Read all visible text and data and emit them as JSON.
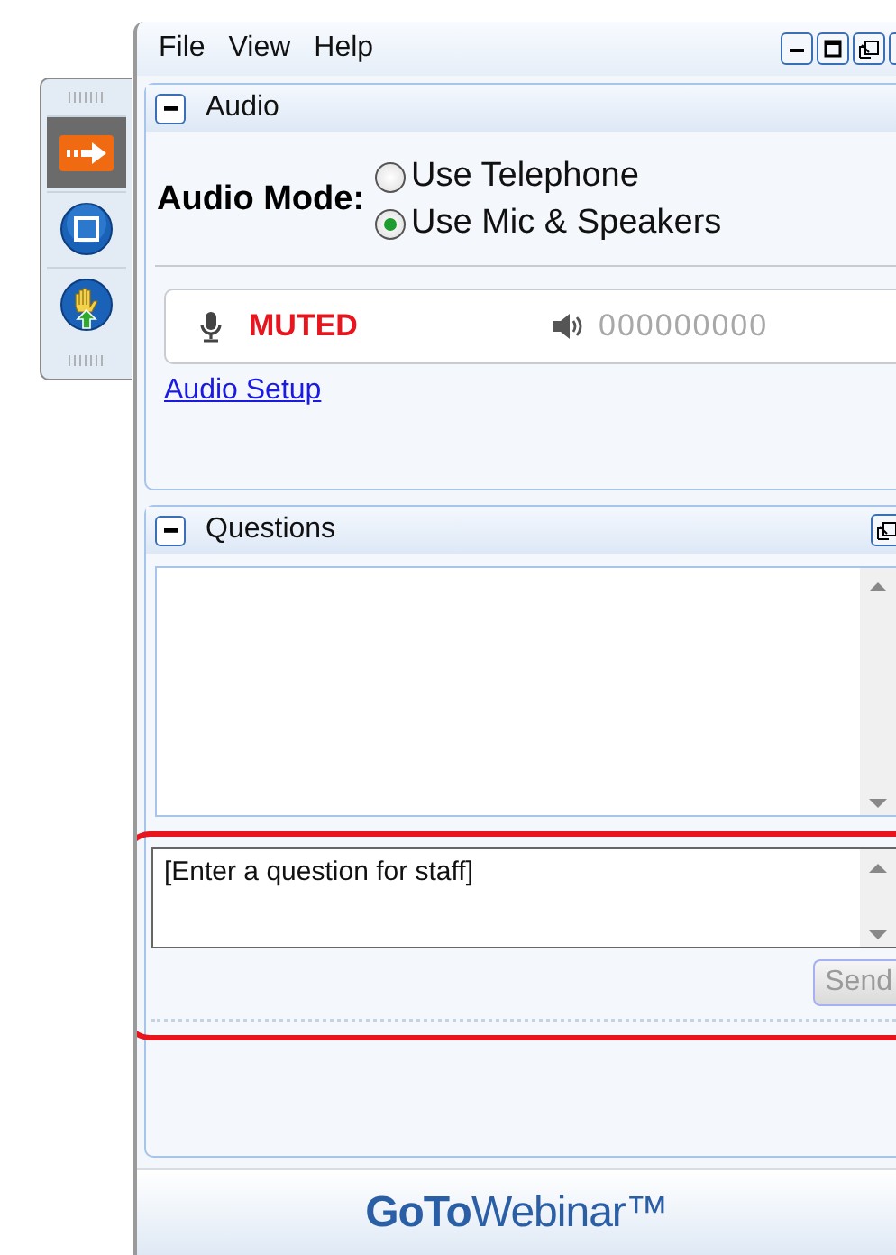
{
  "toolbar": {
    "buttons": [
      {
        "kind": "arrow",
        "selected": true
      },
      {
        "kind": "stop",
        "selected": false
      },
      {
        "kind": "hand",
        "selected": false
      }
    ]
  },
  "menu": [
    "File",
    "View",
    "Help"
  ],
  "audio": {
    "title": "Audio",
    "expanded": true,
    "mode_label": "Audio Mode:",
    "options": [
      {
        "label": "Use Telephone",
        "selected": false
      },
      {
        "label": "Use Mic & Speakers",
        "selected": true
      }
    ],
    "mic_status": "MUTED",
    "speaker_code": "000000000",
    "setup_link": "Audio Setup"
  },
  "questions": {
    "title": "Questions",
    "expanded": true,
    "input": {
      "placeholder": "[Enter a question for staff]"
    },
    "send_button": "Send",
    "send_disabled": true
  },
  "footer": {
    "logo": "**GoTo**Webinar™"
  }
}
